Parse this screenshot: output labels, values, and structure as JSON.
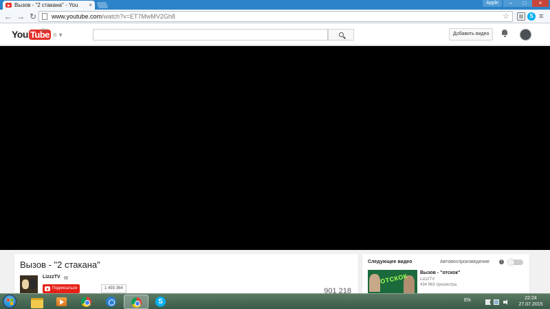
{
  "browser": {
    "tab_title": "Вызов - \"2 стакана\" - You",
    "tab_close": "×",
    "user_badge": "Apple",
    "min": "–",
    "max": "□",
    "close": "×",
    "back": "←",
    "forward": "→",
    "reload": "↻",
    "url_host": "www.youtube.com",
    "url_rest": "/watch?v=ET7MwMV2Gh8",
    "star": "☆",
    "menu": "≡",
    "skype_ext": "S"
  },
  "masthead": {
    "logo_you": "You",
    "logo_tube": "Tube",
    "region": "RU",
    "guide": "≡ ▾",
    "search_value": "",
    "upload_label": "Добавить видео"
  },
  "video": {
    "title": "Вызов - \"2 стакана\"",
    "channel": "LizzzTV",
    "subscribe_label": "Подписаться",
    "subscriber_count": "1 493 364",
    "views": "901 218"
  },
  "sidebar": {
    "up_next_label": "Следующее видео",
    "autoplay_label": "Автовоспроизведение",
    "info": "i",
    "next": {
      "thumb_text": "ОТСКОК",
      "title": "Вызов - \"отскок\"",
      "channel": "LizzzTV",
      "views": "434 963 просмотра"
    }
  },
  "taskbar": {
    "language": "EN",
    "time": "22:24",
    "date": "27.07.2015"
  },
  "colors": {
    "youtube_red": "#e52d27",
    "subscribe_red": "#e62117",
    "chrome_frame": "#2c83c7",
    "taskbar": "#3a5b49"
  }
}
